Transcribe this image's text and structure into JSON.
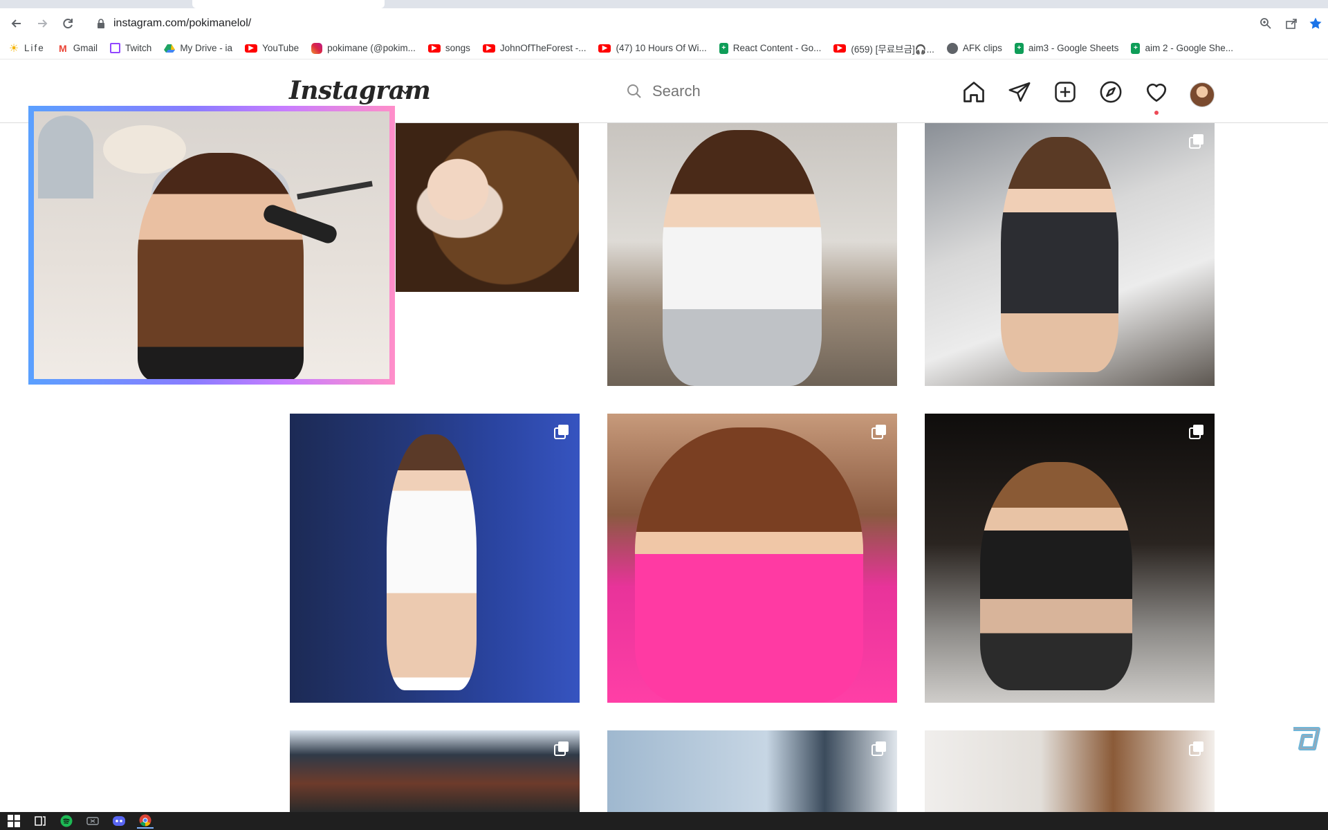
{
  "browser": {
    "url": "instagram.com/pokimanelol/",
    "bookmarks": [
      {
        "label": "Life",
        "icon": "sun-icon",
        "color": "#f5b400"
      },
      {
        "label": "Gmail",
        "icon": "gmail-icon",
        "color": "#ea4335"
      },
      {
        "label": "Twitch",
        "icon": "twitch-icon",
        "color": "#9146ff"
      },
      {
        "label": "My Drive - ia",
        "icon": "drive-icon",
        "color": "#1fa463"
      },
      {
        "label": "YouTube",
        "icon": "youtube-icon",
        "color": "#ff0000"
      },
      {
        "label": "pokimane (@pokim...",
        "icon": "instagram-icon",
        "color": "#d6249f"
      },
      {
        "label": "songs",
        "icon": "youtube-icon",
        "color": "#ff0000"
      },
      {
        "label": "JohnOfTheForest -...",
        "icon": "youtube-icon",
        "color": "#ff0000"
      },
      {
        "label": "(47) 10 Hours Of Wi...",
        "icon": "youtube-icon",
        "color": "#ff0000"
      },
      {
        "label": "React Content - Go...",
        "icon": "sheets-icon",
        "color": "#0f9d58"
      },
      {
        "label": "(659) [무료브금]🎧...",
        "icon": "youtube-icon",
        "color": "#ff0000"
      },
      {
        "label": "AFK clips",
        "icon": "globe-icon",
        "color": "#5f6368"
      },
      {
        "label": "aim3 - Google Sheets",
        "icon": "sheets-icon",
        "color": "#0f9d58"
      },
      {
        "label": "aim 2 - Google She...",
        "icon": "sheets-icon",
        "color": "#0f9d58"
      }
    ]
  },
  "instagram": {
    "logo": "Instagram",
    "search_placeholder": "Search",
    "notification_color": "#ed4956"
  },
  "taskbar": {
    "apps": [
      "windows-start-icon",
      "task-view-icon",
      "spotify-icon",
      "xbox-icon",
      "discord-icon",
      "chrome-icon"
    ]
  },
  "colors": {
    "accent_blue": "#1a73e8",
    "webcam_border_start": "#5aa0ff",
    "webcam_border_end": "#ff8ec9"
  }
}
